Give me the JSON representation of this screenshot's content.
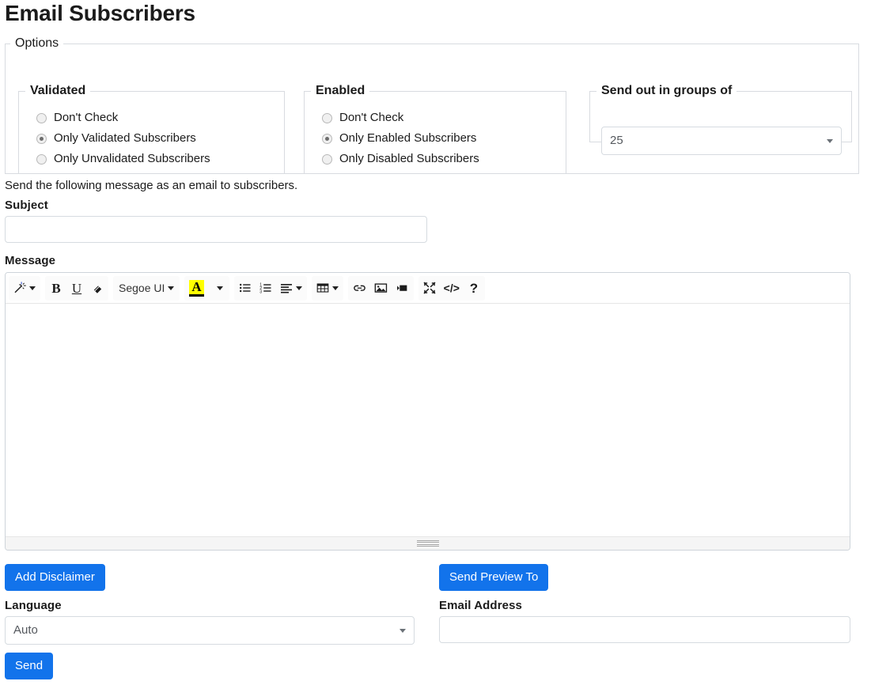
{
  "page": {
    "title": "Email Subscribers"
  },
  "options": {
    "legend": "Options",
    "validated": {
      "legend": "Validated",
      "items": [
        {
          "label": "Don't Check",
          "checked": false
        },
        {
          "label": "Only Validated Subscribers",
          "checked": true
        },
        {
          "label": "Only Unvalidated Subscribers",
          "checked": false
        }
      ]
    },
    "enabled": {
      "legend": "Enabled",
      "items": [
        {
          "label": "Don't Check",
          "checked": false
        },
        {
          "label": "Only Enabled Subscribers",
          "checked": true
        },
        {
          "label": "Only Disabled Subscribers",
          "checked": false
        }
      ]
    },
    "groups": {
      "legend": "Send out in groups of",
      "selected": "25",
      "options": [
        "25"
      ]
    }
  },
  "helper_text": "Send the following message as an email to subscribers.",
  "subject": {
    "label": "Subject",
    "value": "",
    "placeholder": ""
  },
  "message": {
    "label": "Message",
    "content": "",
    "toolbar": {
      "style_label": "style",
      "bold_label": "B",
      "underline_label": "U",
      "eraser_label": "eraser",
      "font_name": "Segoe UI",
      "font_color_label": "A",
      "unordered_list_label": "unordered-list",
      "ordered_list_label": "ordered-list",
      "paragraph_label": "paragraph",
      "table_label": "table",
      "link_label": "link",
      "picture_label": "picture",
      "video_label": "video",
      "fullscreen_label": "fullscreen",
      "codeview_label": "</>",
      "help_label": "?"
    }
  },
  "actions": {
    "add_disclaimer_label": "Add Disclaimer",
    "send_preview_label": "Send Preview To",
    "send_label": "Send"
  },
  "language": {
    "label": "Language",
    "selected": "Auto",
    "options": [
      "Auto"
    ]
  },
  "email_address": {
    "label": "Email Address",
    "value": "",
    "placeholder": ""
  },
  "colors": {
    "primary": "#1273eb",
    "highlight": "#ffff00",
    "border": "#d8dbe0",
    "text": "#1b1b1b"
  }
}
